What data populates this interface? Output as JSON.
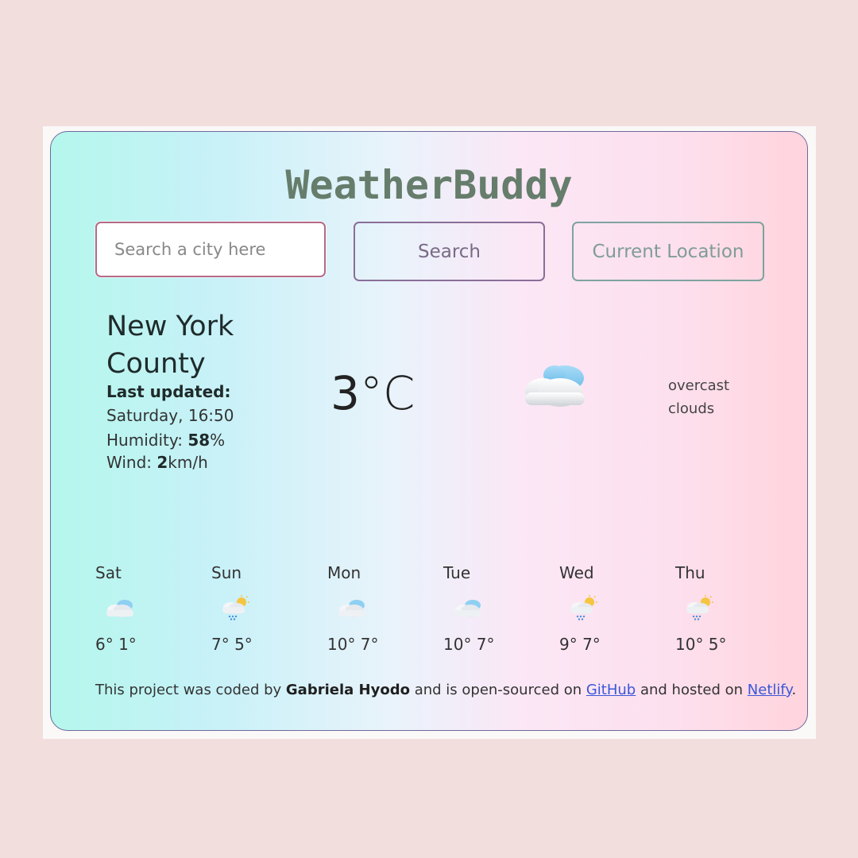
{
  "app": {
    "title": "WeatherBuddy"
  },
  "search": {
    "placeholder": "Search a city here",
    "value": "",
    "search_label": "Search",
    "location_label": "Current Location"
  },
  "current": {
    "city": "New York County",
    "updated_label": "Last updated:",
    "updated_time": "Saturday, 16:50",
    "humidity_label": "Humidity: ",
    "humidity_value": "58",
    "humidity_unit": "%",
    "wind_label": "Wind: ",
    "wind_value": "2",
    "wind_unit": "km/h",
    "temperature": "3",
    "unit": "°C",
    "description": "overcast clouds",
    "icon": "cloud-icon"
  },
  "forecast": [
    {
      "day": "Sat",
      "temps": "6° 1°",
      "icon": "cloud-icon"
    },
    {
      "day": "Sun",
      "temps": "7° 5°",
      "icon": "rain-sun-cloud-icon"
    },
    {
      "day": "Mon",
      "temps": "10° 7°",
      "icon": "cloud-icon"
    },
    {
      "day": "Tue",
      "temps": "10° 7°",
      "icon": "cloud-icon"
    },
    {
      "day": "Wed",
      "temps": "9° 7°",
      "icon": "rain-sun-cloud-icon"
    },
    {
      "day": "Thu",
      "temps": "10° 5°",
      "icon": "rain-sun-cloud-icon"
    }
  ],
  "footer": {
    "prefix": "This project was coded by ",
    "author": "Gabriela Hyodo",
    "middle": " and is open-sourced on ",
    "github_label": "GitHub",
    "middle2": " and hosted on ",
    "netlify_label": "Netlify",
    "suffix": "."
  },
  "colors": {
    "page_background": "#f3dede",
    "title": "#667d6c",
    "link": "#3a57d8"
  }
}
